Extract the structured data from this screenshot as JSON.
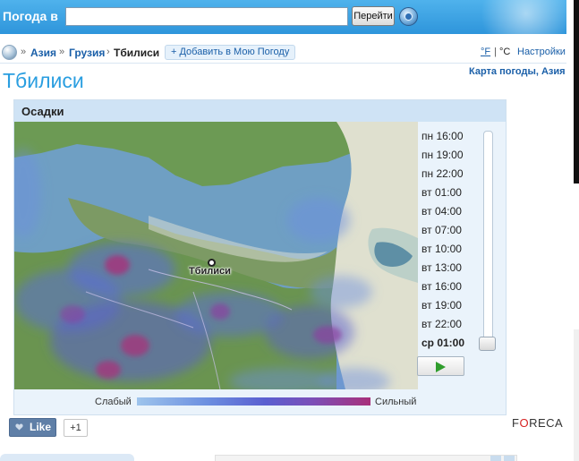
{
  "search": {
    "label": "Погода в",
    "value": "",
    "placeholder": "",
    "go_label": "Перейти"
  },
  "breadcrumb": {
    "items": [
      "Азия",
      "Грузия"
    ],
    "separator": "»",
    "current_separator": "›",
    "current": "Тбилиси",
    "add_favorite": "+ Добавить в Мою Погоду"
  },
  "units": {
    "fahrenheit": "°F",
    "divider": "|",
    "celsius": "°C",
    "settings": "Настройки"
  },
  "page_title": "Тбилиси",
  "region_map_link": "Карта погоды, Азия",
  "panel": {
    "title": "Осадки",
    "map_city_label": "Тбилиси",
    "times": [
      "пн 16:00",
      "пн 19:00",
      "пн 22:00",
      "вт 01:00",
      "вт 04:00",
      "вт 07:00",
      "вт 10:00",
      "вт 13:00",
      "вт 16:00",
      "вт 19:00",
      "вт 22:00",
      "ср 01:00"
    ],
    "selected_time_index": 11,
    "legend_weak": "Слабый",
    "legend_strong": "Сильный"
  },
  "social": {
    "like_label": "Like",
    "like_count": "+1"
  },
  "brand": {
    "logo_before": "F",
    "logo_o": "O",
    "logo_after": "RECA"
  },
  "colors": {
    "topbar": "#2e95db",
    "link": "#1a5fa8",
    "title": "#2a9ee0",
    "panel_header": "#cfe3f5",
    "sea": "#6fa1c4",
    "land": "#6f9c55",
    "precip_light": "#6c8fe0",
    "precip_heavy": "#a8307a"
  },
  "icons": {
    "globe": "globe-icon",
    "locate": "locate-icon",
    "play": "play-icon",
    "like": "heart-icon"
  }
}
